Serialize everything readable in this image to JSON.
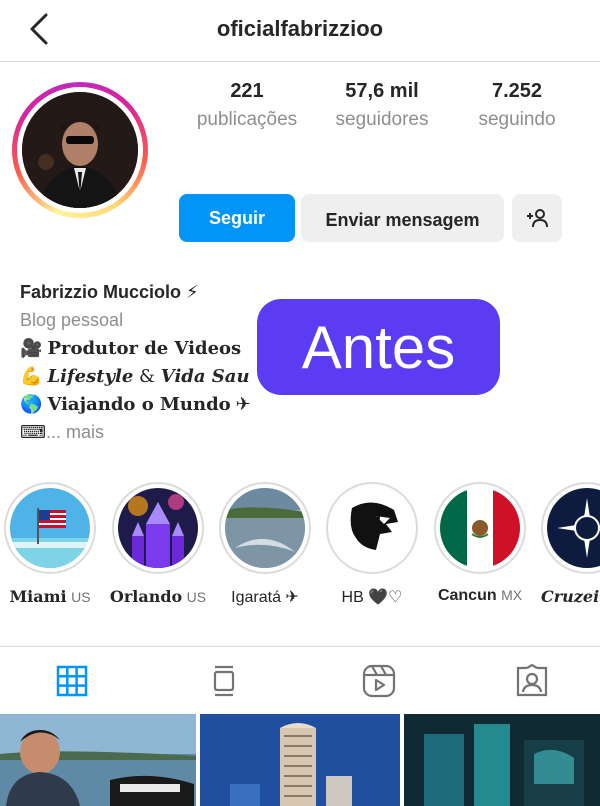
{
  "header": {
    "username": "oficialfabrizzioo"
  },
  "stats": [
    {
      "value": "221",
      "label": "publicações"
    },
    {
      "value": "57,6 mil",
      "label": "seguidores"
    },
    {
      "value": "7.252",
      "label": "seguindo"
    }
  ],
  "actions": {
    "follow": "Seguir",
    "message": "Enviar mensagem"
  },
  "bio": {
    "name": "Fabrizzio Mucciolo ⚡",
    "category": "Blog pessoal",
    "line1_emoji": "🎥",
    "line1_text": "Produtor de Videos",
    "line2_emoji": "💪",
    "line2_a": "Lifestyle",
    "line2_amp": " & ",
    "line2_b": "Vida Sau",
    "line3_emoji": "🌎",
    "line3_text": "Viajando o Mundo",
    "line3_end": " ✈",
    "more_emoji": "⌨",
    "more": "... mais"
  },
  "overlay": {
    "text": "Antes"
  },
  "highlights": [
    {
      "title": "Miami",
      "suffix": "US"
    },
    {
      "title": "Orlando",
      "suffix": "US"
    },
    {
      "title": "Igaratá",
      "suffix": "✈"
    },
    {
      "title": "HB",
      "suffix": "🖤♡"
    },
    {
      "title": "Cancun",
      "suffix": "MX"
    },
    {
      "title": "Cruzeir",
      "suffix": ""
    }
  ],
  "icons": [
    "back-arrow-icon",
    "add-user-icon",
    "grid-icon",
    "feed-icon",
    "reels-icon",
    "tagged-icon"
  ],
  "colors": {
    "accent": "#0095f6",
    "overlay": "#5b3cf2",
    "muted": "#8e8e8e"
  }
}
